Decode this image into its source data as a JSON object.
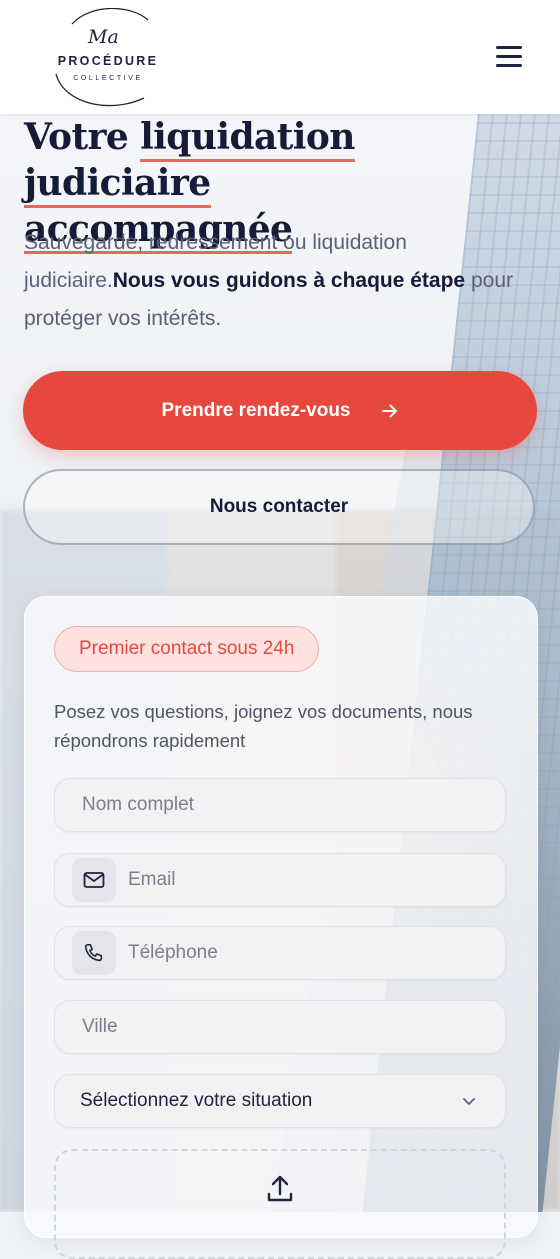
{
  "header": {
    "logo": {
      "script": "Ma",
      "main": "PROCÉDURE",
      "sub": "COLLECTIVE"
    },
    "menu_icon": "hamburger-icon"
  },
  "hero": {
    "title_line1_part1": "Votre ",
    "title_line1_part2": "liquidation judiciaire",
    "title_line2": "accompagnée",
    "subtitle_plain": "Sauvegarde, redressement ou liquidation judiciaire.",
    "subtitle_bold": "Nous vous guidons à chaque étape",
    "subtitle_end": " pour protéger vos intérêts.",
    "primary_button": "Prendre rendez-vous",
    "primary_icon": "arrow-right-icon",
    "secondary_button": "Nous contacter"
  },
  "form": {
    "badge": "Premier contact sous 24h",
    "intro": "Posez vos questions, joignez vos documents, nous répondrons rapidement",
    "name_placeholder": "Nom complet",
    "email_placeholder": "Email",
    "phone_placeholder": "Téléphone",
    "city_placeholder": "Ville",
    "situation_select": "Sélectionnez votre situation",
    "upload_icon": "upload-icon"
  },
  "colors": {
    "accent": "#e6483d",
    "navy": "#161b38",
    "badge_bg": "#fde2df"
  }
}
